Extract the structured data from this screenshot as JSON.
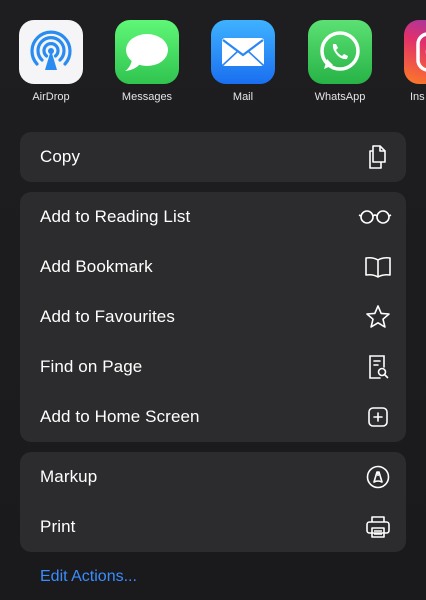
{
  "apps": [
    {
      "id": "airdrop",
      "label": "AirDrop",
      "icon": "airdrop-icon"
    },
    {
      "id": "messages",
      "label": "Messages",
      "icon": "messages-icon"
    },
    {
      "id": "mail",
      "label": "Mail",
      "icon": "mail-icon"
    },
    {
      "id": "whatsapp",
      "label": "WhatsApp",
      "icon": "whatsapp-icon"
    },
    {
      "id": "instagram",
      "label": "Ins",
      "icon": "instagram-icon"
    }
  ],
  "groups": {
    "copy": [
      {
        "label": "Copy",
        "icon": "copy-icon"
      }
    ],
    "main": [
      {
        "label": "Add to Reading List",
        "icon": "glasses-icon"
      },
      {
        "label": "Add Bookmark",
        "icon": "book-icon"
      },
      {
        "label": "Add to Favourites",
        "icon": "star-icon"
      },
      {
        "label": "Find on Page",
        "icon": "find-on-page-icon"
      },
      {
        "label": "Add to Home Screen",
        "icon": "plus-square-icon"
      }
    ],
    "tools": [
      {
        "label": "Markup",
        "icon": "markup-icon"
      },
      {
        "label": "Print",
        "icon": "printer-icon"
      }
    ]
  },
  "edit_actions_label": "Edit Actions...",
  "colors": {
    "background": "#1c1c1e",
    "group_background": "#2c2c2e",
    "text": "#ffffff",
    "link": "#3a8dff"
  }
}
